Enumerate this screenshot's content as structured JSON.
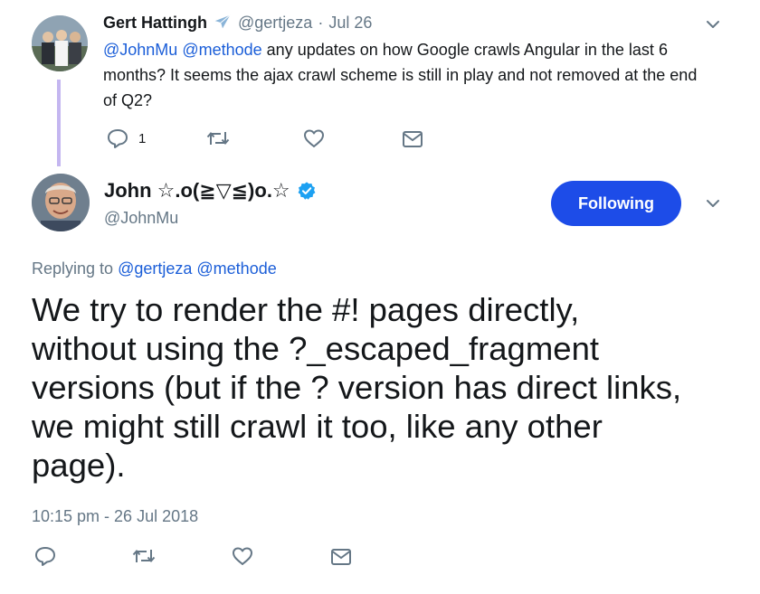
{
  "reply_tweet": {
    "author_name": "Gert Hattingh",
    "author_handle": "@gertjeza",
    "separator": "·",
    "date": "Jul 26",
    "mention_1": "@JohnMu",
    "mention_2": "@methode",
    "text": "any updates on how Google crawls Angular in the last 6 months? It seems the ajax crawl scheme is still in play and not removed at the end of Q2?",
    "reply_count": "1"
  },
  "main_tweet": {
    "author_name": "John ☆.o(≧▽≦)o.☆",
    "author_handle": "@JohnMu",
    "follow_button_label": "Following",
    "replying_to_label": "Replying to",
    "replying_mention_1": "@gertjeza",
    "replying_mention_2": "@methode",
    "text": "We try to render the #! pages directly, without using the ?_escaped_fragment versions (but if the ? version has direct links, we might still crawl it too, like any other page).",
    "timestamp": "10:15 pm - 26 Jul 2018"
  },
  "colors": {
    "link": "#1b5ed8",
    "follow_button": "#1d4ce8",
    "muted": "#657786",
    "verified": "#1da1f2",
    "thread_line": "#c4b6f0"
  },
  "icons": {
    "airplane": "airplane-icon",
    "verified": "verified-badge-icon",
    "chevron": "chevron-down-icon",
    "reply": "reply-icon",
    "retweet": "retweet-icon",
    "like": "heart-icon",
    "dm": "envelope-icon"
  }
}
